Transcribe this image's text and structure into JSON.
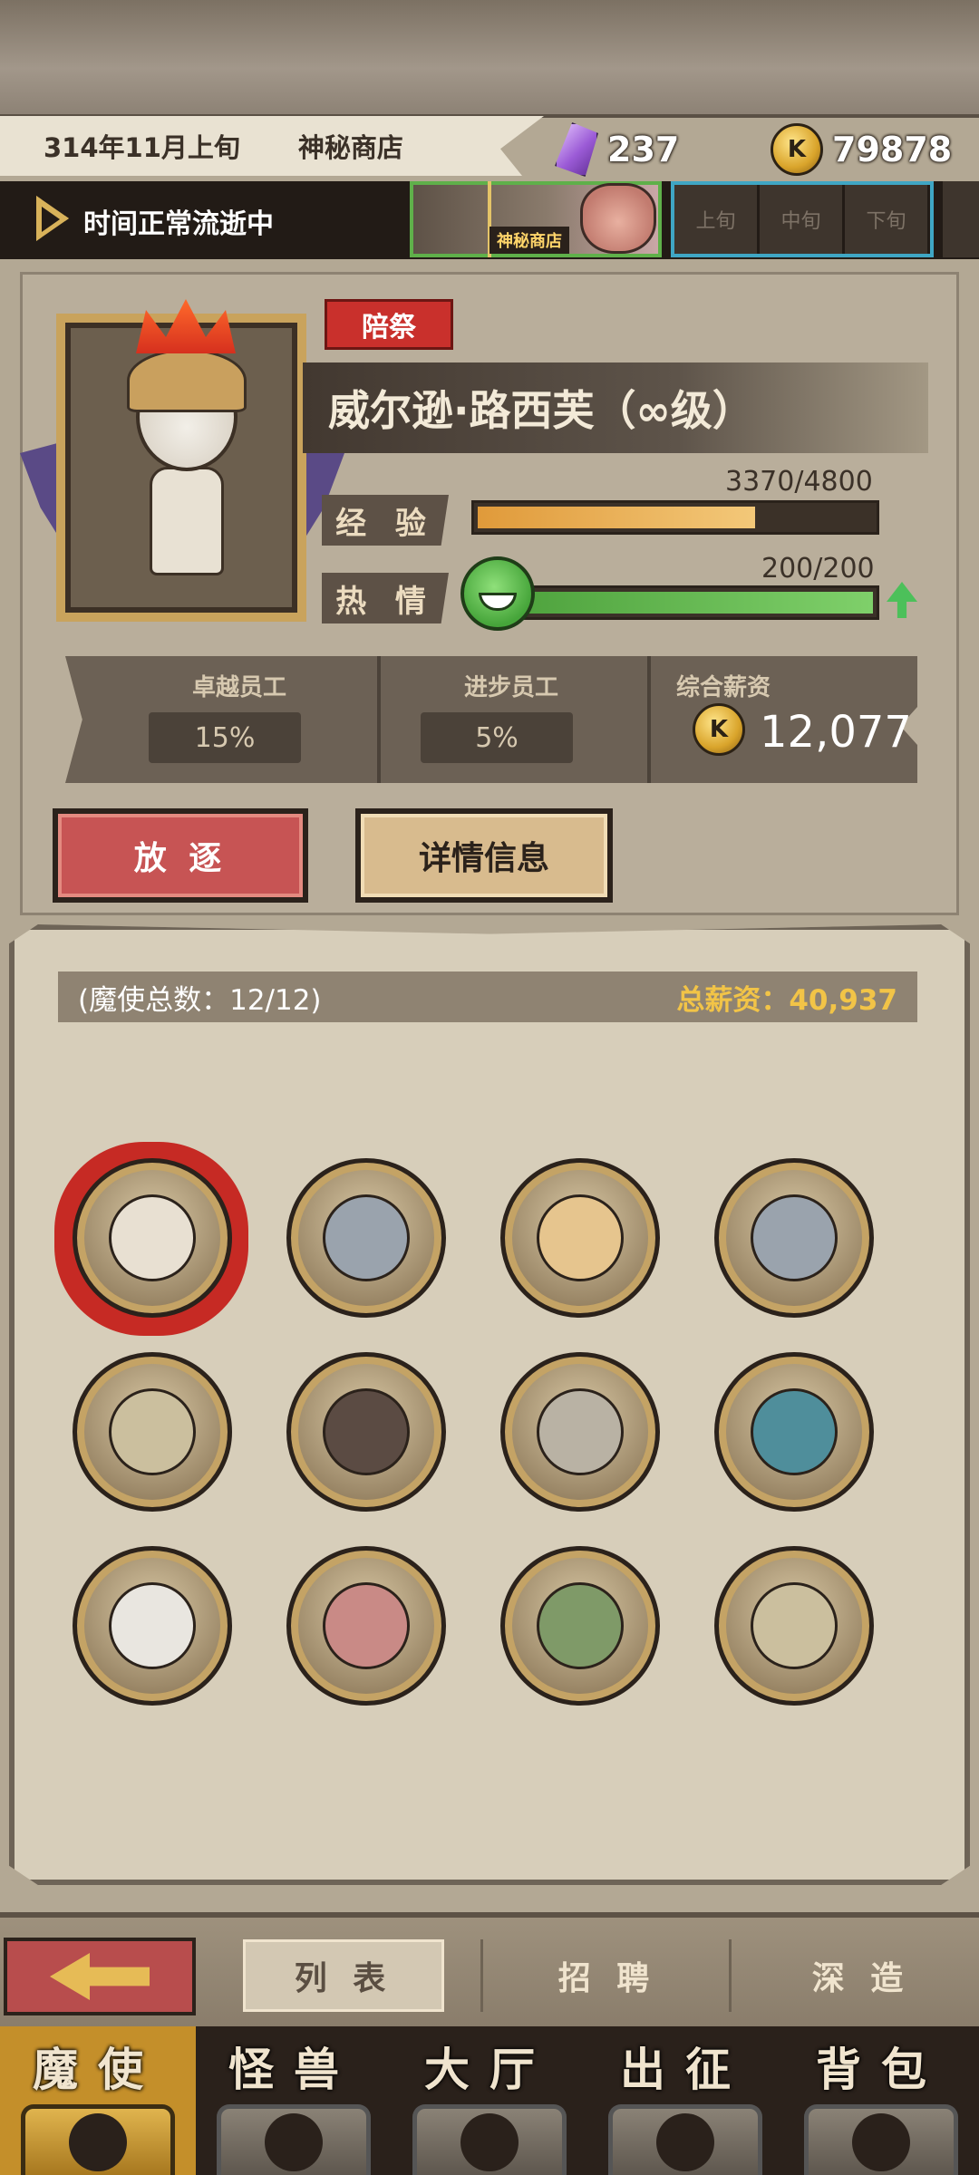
{
  "top_bar": {
    "date": "314年11月上旬",
    "location": "神秘商店",
    "gems": "237",
    "coins": "79878"
  },
  "time_bar": {
    "status": "时间正常流逝中",
    "shop_label": "神秘商店",
    "periods": [
      "上旬",
      "中旬",
      "下旬"
    ]
  },
  "character": {
    "tag": "陪祭",
    "name": "威尔逊·路西芙（∞级）",
    "exp_label": "经 验",
    "exp_value": "3370/4800",
    "exp_fraction": 0.702,
    "passion_label": "热 情",
    "passion_value": "200/200",
    "passion_fraction": 1.0
  },
  "info": {
    "excellent_title": "卓越员工",
    "excellent_value": "15%",
    "progress_title": "进步员工",
    "progress_value": "5%",
    "salary_title": "综合薪资",
    "salary_value": "12,077"
  },
  "actions": {
    "exile": "放 逐",
    "detail": "详情信息"
  },
  "list": {
    "count": "(魔使总数：12/12)",
    "total_salary": "总薪资：40,937",
    "avatars": [
      {
        "name": "avatar-lucifer",
        "color": "#e8e0d2",
        "selected": true
      },
      {
        "name": "avatar-armored-1",
        "color": "#9aa3ad"
      },
      {
        "name": "avatar-witch",
        "color": "#e6c58e"
      },
      {
        "name": "avatar-armored-2",
        "color": "#9aa3ad"
      },
      {
        "name": "avatar-lion-1",
        "color": "#cbbf9e"
      },
      {
        "name": "avatar-dark-girl",
        "color": "#5b4b43"
      },
      {
        "name": "avatar-skull-warrior",
        "color": "#b9b2a4"
      },
      {
        "name": "avatar-hooded-mage",
        "color": "#4f8e9b"
      },
      {
        "name": "avatar-white-hair",
        "color": "#e9e6e0"
      },
      {
        "name": "avatar-eye-creature",
        "color": "#c98a86"
      },
      {
        "name": "avatar-goblin",
        "color": "#7f9a68"
      },
      {
        "name": "avatar-lion-2",
        "color": "#cbbf9e"
      }
    ]
  },
  "sub_nav": {
    "tabs": [
      "列 表",
      "招 聘",
      "深 造"
    ]
  },
  "main_nav": {
    "items": [
      "魔使",
      "怪兽",
      "大厅",
      "出征",
      "背包"
    ]
  },
  "colors": {
    "exile": "#c75454",
    "exp_bar": "#e6a646",
    "passion_bar": "#5fb04a",
    "accent_gold": "#f2c447"
  }
}
